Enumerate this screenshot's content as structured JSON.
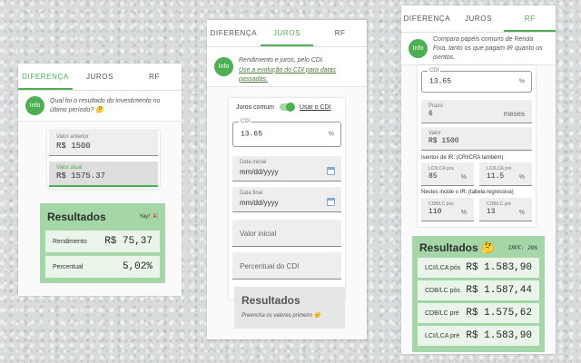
{
  "panel1": {
    "tabs": [
      "DIFERENÇA",
      "JUROS",
      "RF"
    ],
    "info_icon": "Info",
    "info_text": "Qual foi o resultado do investimento no último período? 🤔",
    "valor_anterior_label": "Valor anterior",
    "valor_anterior_value": "R$ 1500",
    "valor_atual_label": "Valor atual",
    "valor_atual_value": "R$ 1575.37",
    "results_title": "Resultados",
    "results_badge": "Yay! 🎉",
    "rows": [
      {
        "label": "Rendimento",
        "value": "R$ 75,37"
      },
      {
        "label": "Percentual",
        "value": "5,02%"
      }
    ]
  },
  "panel2": {
    "tabs": [
      "DIFERENÇA",
      "JUROS",
      "RF"
    ],
    "info_icon": "Info",
    "info_text": "Rendimento e juros, pelo CDI.",
    "info_link": "Use a evolução do CDI para datas passadas.",
    "toggle_left": "Juros comum",
    "toggle_right": "Usar o CDI",
    "cdi_label": "CDI",
    "cdi_value": "13.65",
    "cdi_suffix": "%",
    "data_inicial_label": "Data inicial",
    "data_inicial_value": "mm/dd/yyyy",
    "data_final_label": "Data final",
    "data_final_value": "mm/dd/yyyy",
    "valor_inicial_label": "Valor inicial",
    "percentual_label": "Percentual do CDI",
    "results_title": "Resultados",
    "results_hint": "Preencha os valores primeiro 😐"
  },
  "panel3": {
    "tabs": [
      "DIFERENÇA",
      "JUROS",
      "RF"
    ],
    "info_icon": "Info",
    "info_text": "Compara papéis comuns de Renda Fixa, tanto os que pagam IR quanto os isentos.",
    "cdi_label": "CDI",
    "cdi_value": "13.65",
    "cdi_suffix": "%",
    "prazo_label": "Prazo",
    "prazo_value": "6",
    "prazo_suffix": "meses",
    "valor_label": "Valor",
    "valor_value": "R$ 1500",
    "isentos_label": "Isentos de IR: (CRI/CRA também)",
    "lci_pos_label": "LCI/LCA pós",
    "lci_pos_value": "85",
    "lci_pre_label": "LCI/LCA pré",
    "lci_pre_value": "11.5",
    "nestes_label": "Nestes incide o IR: (tabela regressiva)",
    "cdb_pos_label": "CDB/LC pós",
    "cdb_pos_value": "110",
    "cdb_pre_label": "CDB/LC pré",
    "cdb_pre_value": "13",
    "pct": "%",
    "results_title": "Resultados 🤔",
    "irpf": "IRPF: 20%",
    "rows": [
      {
        "label": "LCI/LCA pós",
        "value": "R$ 1.583,90"
      },
      {
        "label": "CDB/LC pós",
        "value": "R$ 1.587,44"
      },
      {
        "label": "CDB/LC pré",
        "value": "R$ 1.575,62"
      },
      {
        "label": "LCI/LCA pré",
        "value": "R$ 1.583,90"
      }
    ]
  }
}
